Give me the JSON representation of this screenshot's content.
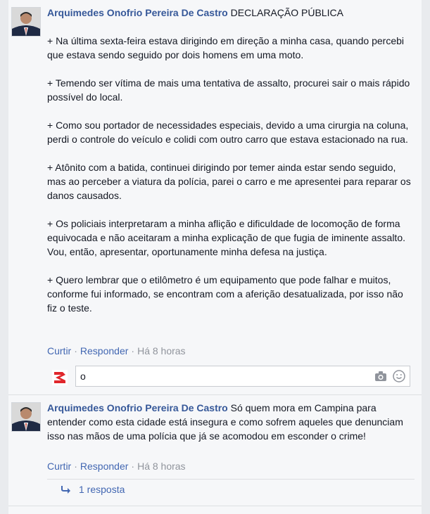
{
  "comments": [
    {
      "author": "Arquimedes Onofrio Pereira De Castro",
      "heading": "DECLARAÇÃO PÚBLICA",
      "paragraphs": [
        "+ Na última sexta-feira estava dirigindo em direção a minha casa, quando percebi que estava sendo seguido por dois homens em uma moto.",
        "+ Temendo ser vítima de mais uma tentativa de assalto, procurei sair o mais rápido possível do local.",
        "+ Como sou portador de necessidades especiais, devido a uma cirurgia na coluna, perdi o controle do veículo e colidi com outro carro que estava estacionado na rua.",
        "+ Atônito com a batida, continuei dirigindo por temer ainda estar sendo seguido, mas ao perceber a viatura da polícia, parei o carro e me apresentei para reparar os danos causados.",
        "+ Os policiais interpretaram a minha aflição e dificuldade de locomoção de forma equivocada e não aceitaram a minha explicação de que fugia de iminente assalto. Vou, então, apresentar, oportunamente minha defesa na justiça.",
        "+ Quero lembrar que o etilômetro é um equipamento que pode falhar e muitos, conforme fui informado, se encontram com a aferição desatualizada, por isso não fiz o teste."
      ],
      "actions": {
        "like": "Curtir",
        "reply": "Responder",
        "time": "Há 8 horas"
      }
    },
    {
      "author": "Arquimedes Onofrio Pereira De Castro",
      "text": "Só quem mora em Campina para entender como esta cidade está insegura e como sofrem aqueles que denunciam isso nas mãos de uma polícia que já se acomodou em esconder o crime!",
      "actions": {
        "like": "Curtir",
        "reply": "Responder",
        "time": "Há 8 horas"
      },
      "replies_label": "1 resposta"
    }
  ],
  "reply_input": {
    "value": "o"
  },
  "separator": "·",
  "colors": {
    "link": "#4267b2",
    "author": "#365899",
    "muted": "#90949c",
    "logo_red": "#e0262b"
  },
  "icons": [
    "camera-icon",
    "smiley-icon",
    "reply-arrow-icon",
    "page-logo-icon"
  ]
}
